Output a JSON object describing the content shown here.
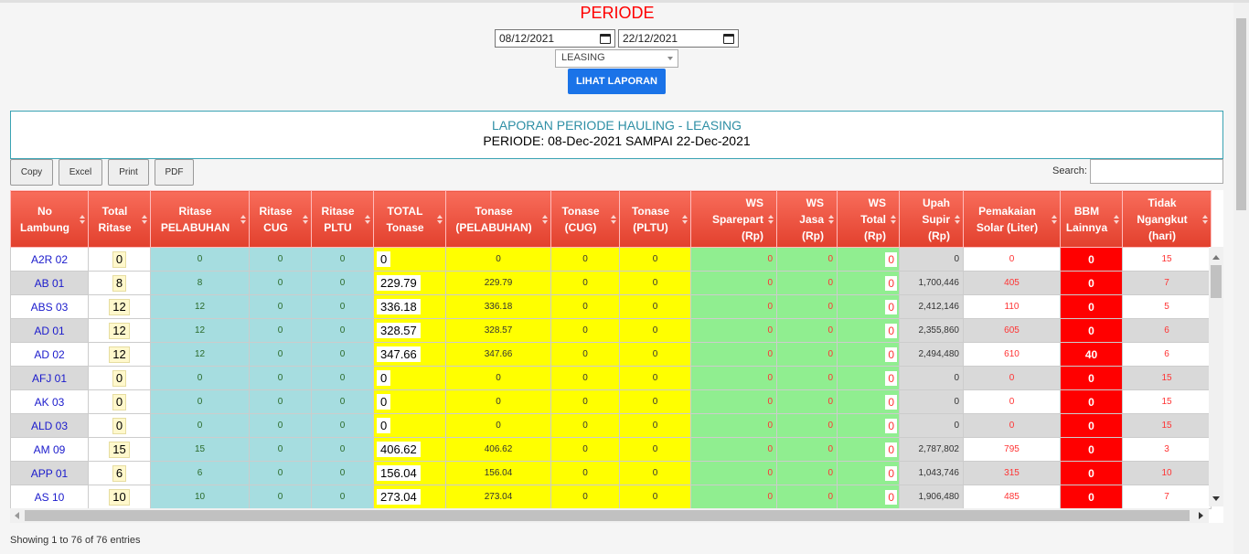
{
  "form": {
    "title": "PERIODE",
    "date_from": "08/12/2021",
    "date_to": "22/12/2021",
    "category": "LEASING",
    "submit_label": "LIHAT LAPORAN"
  },
  "report": {
    "title": "LAPORAN PERIODE HAULING - LEASING",
    "period": "PERIODE: 08-Dec-2021 SAMPAI 22-Dec-2021"
  },
  "toolbar": {
    "copy": "Copy",
    "excel": "Excel",
    "print": "Print",
    "pdf": "PDF",
    "search_label": "Search:"
  },
  "columns": [
    [
      "No",
      "Lambung"
    ],
    [
      "Total",
      "Ritase"
    ],
    [
      "Ritase",
      "PELABUHAN"
    ],
    [
      "Ritase",
      "CUG"
    ],
    [
      "Ritase",
      "PLTU"
    ],
    [
      "TOTAL",
      "Tonase"
    ],
    [
      "Tonase",
      "(PELABUHAN)"
    ],
    [
      "Tonase",
      "(CUG)"
    ],
    [
      "Tonase",
      "(PLTU)"
    ],
    [
      "WS",
      "Sparepart",
      "(Rp)"
    ],
    [
      "WS",
      "Jasa",
      "(Rp)"
    ],
    [
      "WS",
      "Total",
      "(Rp)"
    ],
    [
      "Upah",
      "Supir",
      "(Rp)"
    ],
    [
      "Pemakaian",
      "Solar (Liter)"
    ],
    [
      "BBM",
      "Lainnya"
    ],
    [
      "Tidak",
      "Ngangkut",
      "(hari)"
    ]
  ],
  "rows": [
    [
      "A2R 02",
      "0",
      "0",
      "0",
      "0",
      "0",
      "0",
      "0",
      "0",
      "0",
      "0",
      "0",
      "0",
      "0",
      "0",
      "15"
    ],
    [
      "AB 01",
      "8",
      "8",
      "0",
      "0",
      "229.79",
      "229.79",
      "0",
      "0",
      "0",
      "0",
      "0",
      "1,700,446",
      "405",
      "0",
      "7"
    ],
    [
      "ABS 03",
      "12",
      "12",
      "0",
      "0",
      "336.18",
      "336.18",
      "0",
      "0",
      "0",
      "0",
      "0",
      "2,412,146",
      "110",
      "0",
      "5"
    ],
    [
      "AD 01",
      "12",
      "12",
      "0",
      "0",
      "328.57",
      "328.57",
      "0",
      "0",
      "0",
      "0",
      "0",
      "2,355,860",
      "605",
      "0",
      "6"
    ],
    [
      "AD 02",
      "12",
      "12",
      "0",
      "0",
      "347.66",
      "347.66",
      "0",
      "0",
      "0",
      "0",
      "0",
      "2,494,480",
      "610",
      "40",
      "6"
    ],
    [
      "AFJ 01",
      "0",
      "0",
      "0",
      "0",
      "0",
      "0",
      "0",
      "0",
      "0",
      "0",
      "0",
      "0",
      "0",
      "0",
      "15"
    ],
    [
      "AK 03",
      "0",
      "0",
      "0",
      "0",
      "0",
      "0",
      "0",
      "0",
      "0",
      "0",
      "0",
      "0",
      "0",
      "0",
      "15"
    ],
    [
      "ALD 03",
      "0",
      "0",
      "0",
      "0",
      "0",
      "0",
      "0",
      "0",
      "0",
      "0",
      "0",
      "0",
      "0",
      "0",
      "15"
    ],
    [
      "AM 09",
      "15",
      "15",
      "0",
      "0",
      "406.62",
      "406.62",
      "0",
      "0",
      "0",
      "0",
      "0",
      "2,787,802",
      "795",
      "0",
      "3"
    ],
    [
      "APP 01",
      "6",
      "6",
      "0",
      "0",
      "156.04",
      "156.04",
      "0",
      "0",
      "0",
      "0",
      "0",
      "1,043,746",
      "315",
      "0",
      "10"
    ],
    [
      "AS 10",
      "10",
      "10",
      "0",
      "0",
      "273.04",
      "273.04",
      "0",
      "0",
      "0",
      "0",
      "0",
      "1,906,480",
      "485",
      "0",
      "7"
    ]
  ],
  "footer": {
    "info": "Showing 1 to 76 of 76 entries"
  },
  "colors": {
    "header": "#e84a36",
    "bbm": "#ff0000",
    "tonase": "#ffff00",
    "ws": "#90ee90",
    "ritase": "#a6dde0",
    "report_title": "#2e8fa5",
    "submit": "#1a73e8"
  }
}
